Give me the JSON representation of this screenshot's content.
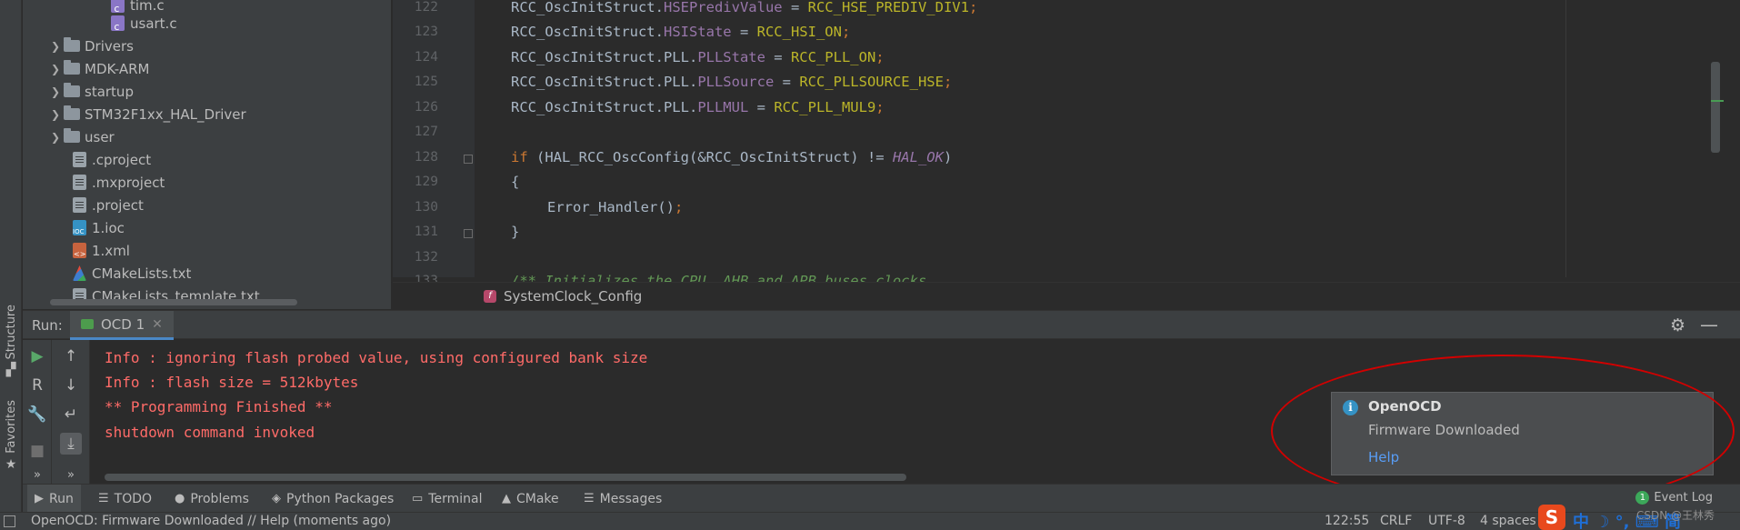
{
  "left_strip": {
    "structure_label": "Structure",
    "favorites_label": "Favorites"
  },
  "project_tree": {
    "items": [
      {
        "label": "tim.c",
        "type": "c"
      },
      {
        "label": "usart.c",
        "type": "c"
      },
      {
        "label": "Drivers",
        "type": "folder"
      },
      {
        "label": "MDK-ARM",
        "type": "folder"
      },
      {
        "label": "startup",
        "type": "folder"
      },
      {
        "label": "STM32F1xx_HAL_Driver",
        "type": "folder"
      },
      {
        "label": "user",
        "type": "folder"
      },
      {
        "label": ".cproject",
        "type": "doc"
      },
      {
        "label": ".mxproject",
        "type": "doc"
      },
      {
        "label": ".project",
        "type": "doc"
      },
      {
        "label": "1.ioc",
        "type": "ioc"
      },
      {
        "label": "1.xml",
        "type": "xml"
      },
      {
        "label": "CMakeLists.txt",
        "type": "cmake"
      },
      {
        "label": "CMakeLists_template.txt",
        "type": "doc"
      }
    ]
  },
  "editor": {
    "line_numbers": [
      "122",
      "123",
      "124",
      "125",
      "126",
      "127",
      "128",
      "129",
      "130",
      "131",
      "132",
      "133"
    ],
    "lines": {
      "l122": {
        "obj": "RCC_OscInitStruct.",
        "field": "HSEPredivValue",
        "op": " = ",
        "val": "RCC_HSE_PREDIV_DIV1",
        "end": ";"
      },
      "l123": {
        "obj": "RCC_OscInitStruct.",
        "field": "HSIState",
        "op": " = ",
        "val": "RCC_HSI_ON",
        "end": ";"
      },
      "l124": {
        "obj": "RCC_OscInitStruct.PLL.",
        "field": "PLLState",
        "op": " = ",
        "val": "RCC_PLL_ON",
        "end": ";"
      },
      "l125": {
        "obj": "RCC_OscInitStruct.PLL.",
        "field": "PLLSource",
        "op": " = ",
        "val": "RCC_PLLSOURCE_HSE",
        "end": ";"
      },
      "l126": {
        "obj": "RCC_OscInitStruct.PLL.",
        "field": "PLLMUL",
        "op": " = ",
        "val": "RCC_PLL_MUL9",
        "end": ";"
      },
      "l128": {
        "kw": "if",
        "a": " (HAL_RCC_OscConfig(&RCC_OscInitStruct) != ",
        "ital": "HAL_OK",
        "b": ")"
      },
      "l129": "{",
      "l130": {
        "a": "Error_Handler()",
        "end": ";"
      },
      "l131": "}",
      "l133": "/** Initializes the CPU, AHB and APB buses clocks"
    },
    "breadcrumb": "SystemClock_Config"
  },
  "run_panel": {
    "label": "Run:",
    "tab_label": "OCD 1",
    "console_lines": [
      "Info : ignoring flash probed value, using configured bank size",
      "Info : flash size = 512kbytes",
      "** Programming Finished **",
      "shutdown command invoked"
    ]
  },
  "notification": {
    "title": "OpenOCD",
    "body": "Firmware Downloaded",
    "link": "Help"
  },
  "tool_tabs": {
    "run": "Run",
    "todo": "TODO",
    "problems": "Problems",
    "python_packages": "Python Packages",
    "terminal": "Terminal",
    "cmake": "CMake",
    "messages": "Messages",
    "event_log": "Event Log",
    "event_count": "1"
  },
  "status_bar": {
    "message": "OpenOCD: Firmware Downloaded // Help (moments ago)",
    "position": "122:55",
    "line_sep": "CRLF",
    "encoding": "UTF-8",
    "indent": "4 spaces",
    "ime_text": "中 ☽ °, ⌨ 简",
    "watermark": "CSDN @王林秀"
  },
  "colors": {
    "accent": "#4a88c7",
    "console_error": "#ff6b68",
    "annotation_ellipse": "#d20000",
    "link": "#589df6"
  }
}
